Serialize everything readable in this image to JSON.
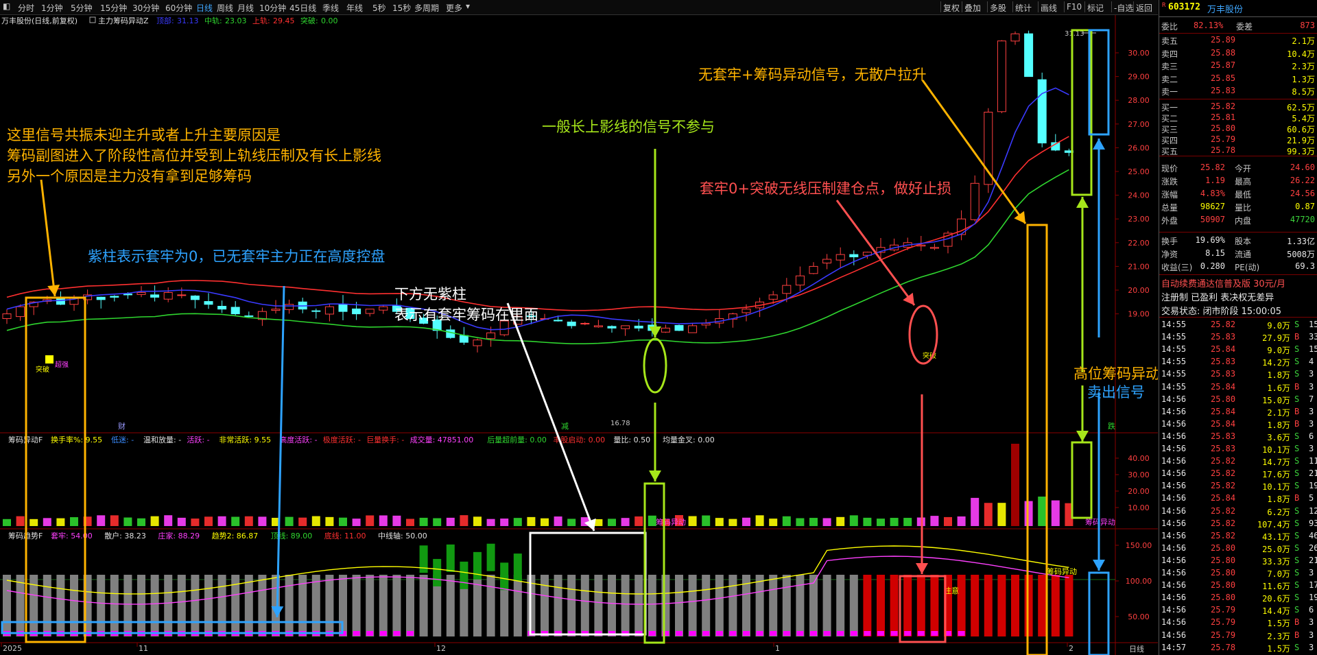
{
  "toolbar": {
    "periods": [
      "分时",
      "1分钟",
      "5分钟",
      "15分钟",
      "30分钟",
      "60分钟",
      "日线",
      "周线",
      "月线",
      "10分钟",
      "45日线",
      "季线",
      "年线",
      "5秒",
      "15秒",
      "多周期",
      "更多"
    ],
    "active_period": "日线",
    "right_buttons": [
      "复权",
      "叠加",
      "多股",
      "统计",
      "画线",
      "F10",
      "标记",
      "-自选",
      "返回"
    ]
  },
  "main": {
    "stock_title": "万丰股份(日线,前复权)",
    "indicator_name": "主力筹码异动Z",
    "lines": [
      {
        "label": "顶部:",
        "value": "31.13",
        "color": "#3a3aff"
      },
      {
        "label": "中轨:",
        "value": "23.03",
        "color": "#2fd62f"
      },
      {
        "label": "上轨:",
        "value": "29.45",
        "color": "#ff3030"
      },
      {
        "label": "突破:",
        "value": "0.00",
        "color": "#2fd62f"
      }
    ],
    "price_axis": [
      "30.00",
      "29.00",
      "28.00",
      "27.00",
      "26.00",
      "25.00",
      "24.00",
      "23.00",
      "22.00",
      "21.00",
      "20.00",
      "19.00"
    ],
    "high_label": "31.13",
    "low_label": "16.78",
    "marks": {
      "breakout1": "突破",
      "breakout2": "突破",
      "chao": "超强",
      "cai": "财",
      "jian": "减",
      "die": "跌"
    }
  },
  "sub1": {
    "name": "筹码异动F",
    "items": [
      {
        "t": "换手率%: 9.55",
        "c": "#ffff00"
      },
      {
        "t": "低迷: -",
        "c": "#3a8cff"
      },
      {
        "t": "温和放量: -",
        "c": "#e0e0e0"
      },
      {
        "t": "活跃: -",
        "c": "#ff40ff"
      },
      {
        "t": "非常活跃: 9.55",
        "c": "#ffff00"
      },
      {
        "t": "高度活跃: -",
        "c": "#ff40ff"
      },
      {
        "t": "极度活跃: -",
        "c": "#ff3030"
      },
      {
        "t": "巨量换手: -",
        "c": "#ff3030"
      },
      {
        "t": "成交量: 47851.00",
        "c": "#ff40ff"
      },
      {
        "t": "后量超前量: 0.00",
        "c": "#2fd62f"
      },
      {
        "t": "丰股启动: 0.00",
        "c": "#ff3030"
      },
      {
        "t": "量比: 0.50",
        "c": "#e0e0e0"
      },
      {
        "t": "均量金叉: 0.00",
        "c": "#e0e0e0"
      }
    ],
    "axis": [
      "40.00",
      "30.00",
      "20.00",
      "10.00"
    ],
    "signal_label": "筹码异动"
  },
  "sub2": {
    "name": "筹码趋势F",
    "items": [
      {
        "t": "套牢: 54.00",
        "c": "#ff40ff"
      },
      {
        "t": "散户: 38.23",
        "c": "#e0e0e0"
      },
      {
        "t": "庄家: 88.29",
        "c": "#ff40ff"
      },
      {
        "t": "趋势2: 86.87",
        "c": "#ffff00"
      },
      {
        "t": "顶线: 89.00",
        "c": "#2fd62f"
      },
      {
        "t": "底线: 11.00",
        "c": "#ff3030"
      },
      {
        "t": "中线轴: 50.00",
        "c": "#e0e0e0"
      }
    ],
    "axis": [
      "150.00",
      "100.00",
      "50.00"
    ],
    "signal_label": "筹码异动",
    "attention_label": "注意"
  },
  "date_axis": [
    "2025",
    "11",
    "12",
    "1",
    "2"
  ],
  "bottom_right_label": "日线",
  "annotations": {
    "left_reason": [
      "这里信号共振未迎主升或者上升主要原因是",
      "筹码副图进入了阶段性高位并受到上轨线压制及有长上影线",
      "另外一个原因是主力没有拿到足够筹码"
    ],
    "purple_bar": "紫柱表示套牢为0，已无套牢主力正在高度控盘",
    "no_purple": [
      "下方无紫柱",
      "表示有套牢筹码在里面"
    ],
    "long_shadow": "一般长上影线的信号不参与",
    "no_trap": "无套牢+筹码异动信号，无散户拉升",
    "build_point": "套牢0+突破无线压制建仓点，做好止损",
    "high_signal": "高位筹码异动",
    "sell_signal": "卖出信号"
  },
  "quote": {
    "code": "603172",
    "name": "万丰股份",
    "webi_label": "委比",
    "webi_value": "82.13%",
    "weicha_label": "委差",
    "weicha_value": "873",
    "asks": [
      {
        "label": "卖五",
        "price": "25.89",
        "vol": "2.1万"
      },
      {
        "label": "卖四",
        "price": "25.88",
        "vol": "10.4万"
      },
      {
        "label": "卖三",
        "price": "25.87",
        "vol": "2.3万"
      },
      {
        "label": "卖二",
        "price": "25.85",
        "vol": "1.3万"
      },
      {
        "label": "卖一",
        "price": "25.83",
        "vol": "8.5万"
      }
    ],
    "bids": [
      {
        "label": "买一",
        "price": "25.82",
        "vol": "62.5万"
      },
      {
        "label": "买二",
        "price": "25.81",
        "vol": "5.4万"
      },
      {
        "label": "买三",
        "price": "25.80",
        "vol": "60.6万"
      },
      {
        "label": "买四",
        "price": "25.79",
        "vol": "21.9万"
      },
      {
        "label": "买五",
        "price": "25.78",
        "vol": "99.3万"
      }
    ],
    "stats": [
      {
        "l1": "现价",
        "v1": "25.82",
        "c1": "red",
        "l2": "今开",
        "v2": "24.60",
        "c2": "red"
      },
      {
        "l1": "涨跌",
        "v1": "1.19",
        "c1": "red",
        "l2": "最高",
        "v2": "26.22",
        "c2": "red"
      },
      {
        "l1": "涨幅",
        "v1": "4.83%",
        "c1": "red",
        "l2": "最低",
        "v2": "24.56",
        "c2": "red"
      },
      {
        "l1": "总量",
        "v1": "98627",
        "c1": "yel",
        "l2": "量比",
        "v2": "0.87",
        "c2": "yel"
      },
      {
        "l1": "外盘",
        "v1": "50907",
        "c1": "red",
        "l2": "内盘",
        "v2": "47720",
        "c2": "grn"
      }
    ],
    "stats2": [
      {
        "l1": "换手",
        "v1": "19.69%",
        "l2": "股本",
        "v2": "1.33亿"
      },
      {
        "l1": "净资",
        "v1": "8.15",
        "l2": "流通",
        "v2": "5008万"
      },
      {
        "l1": "收益(三)",
        "v1": "0.280",
        "l2": "PE(动)",
        "v2": "69.3"
      }
    ],
    "ad": "自动续费通达信普及版  30元/月",
    "reg": "注册制 已盈利 表决权无差异",
    "status": "交易状态: 闭市阶段 15:00:05",
    "ticks": [
      {
        "t": "14:55",
        "p": "25.82",
        "v": "9.0万",
        "d": "S",
        "n": "15"
      },
      {
        "t": "14:55",
        "p": "25.83",
        "v": "27.9万",
        "d": "B",
        "n": "33"
      },
      {
        "t": "14:55",
        "p": "25.84",
        "v": "9.0万",
        "d": "S",
        "n": "15"
      },
      {
        "t": "14:55",
        "p": "25.83",
        "v": "14.2万",
        "d": "S",
        "n": "4"
      },
      {
        "t": "14:55",
        "p": "25.83",
        "v": "1.8万",
        "d": "S",
        "n": "3"
      },
      {
        "t": "14:55",
        "p": "25.84",
        "v": "1.6万",
        "d": "B",
        "n": "3"
      },
      {
        "t": "14:56",
        "p": "25.80",
        "v": "15.0万",
        "d": "S",
        "n": "7"
      },
      {
        "t": "14:56",
        "p": "25.84",
        "v": "2.1万",
        "d": "B",
        "n": "3"
      },
      {
        "t": "14:56",
        "p": "25.84",
        "v": "1.8万",
        "d": "B",
        "n": "3"
      },
      {
        "t": "14:56",
        "p": "25.83",
        "v": "3.6万",
        "d": "S",
        "n": "6"
      },
      {
        "t": "14:56",
        "p": "25.83",
        "v": "10.1万",
        "d": "S",
        "n": "3"
      },
      {
        "t": "14:56",
        "p": "25.82",
        "v": "14.7万",
        "d": "S",
        "n": "11"
      },
      {
        "t": "14:56",
        "p": "25.82",
        "v": "17.6万",
        "d": "S",
        "n": "21"
      },
      {
        "t": "14:56",
        "p": "25.82",
        "v": "10.1万",
        "d": "S",
        "n": "19"
      },
      {
        "t": "14:56",
        "p": "25.84",
        "v": "1.8万",
        "d": "B",
        "n": "5"
      },
      {
        "t": "14:56",
        "p": "25.82",
        "v": "6.2万",
        "d": "S",
        "n": "12"
      },
      {
        "t": "14:56",
        "p": "25.82",
        "v": "107.4万",
        "d": "S",
        "n": "93"
      },
      {
        "t": "14:56",
        "p": "25.82",
        "v": "43.1万",
        "d": "S",
        "n": "46"
      },
      {
        "t": "14:56",
        "p": "25.80",
        "v": "25.0万",
        "d": "S",
        "n": "26"
      },
      {
        "t": "14:56",
        "p": "25.80",
        "v": "33.3万",
        "d": "S",
        "n": "21"
      },
      {
        "t": "14:56",
        "p": "25.80",
        "v": "7.0万",
        "d": "S",
        "n": "3"
      },
      {
        "t": "14:56",
        "p": "25.80",
        "v": "11.6万",
        "d": "S",
        "n": "17"
      },
      {
        "t": "14:56",
        "p": "25.80",
        "v": "20.6万",
        "d": "S",
        "n": "19"
      },
      {
        "t": "14:56",
        "p": "25.79",
        "v": "14.4万",
        "d": "S",
        "n": "6"
      },
      {
        "t": "14:56",
        "p": "25.79",
        "v": "1.5万",
        "d": "B",
        "n": "3"
      },
      {
        "t": "14:56",
        "p": "25.79",
        "v": "2.3万",
        "d": "B",
        "n": "3"
      },
      {
        "t": "14:57",
        "p": "25.78",
        "v": "1.5万",
        "d": "S",
        "n": "3"
      }
    ]
  }
}
